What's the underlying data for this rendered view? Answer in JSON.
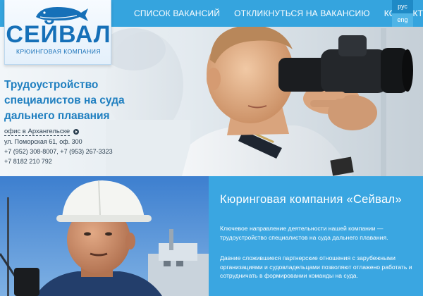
{
  "brand": {
    "logo_name": "СЕЙВАЛ",
    "logo_subtitle": "КРЮИНГОВАЯ КОМПАНИЯ",
    "logo_color": "#1670b8"
  },
  "nav": {
    "items": [
      {
        "label": "СПИСОК ВАКАНСИЙ"
      },
      {
        "label": "ОТКЛИКНУТЬСЯ НА ВАКАНСИЮ"
      },
      {
        "label": "КОНТАКТЫ"
      }
    ],
    "bar_color": "#35a4de"
  },
  "languages": [
    {
      "label": "рус",
      "active": true
    },
    {
      "label": "eng",
      "active": false
    }
  ],
  "hero": {
    "title_lines": [
      "Трудоустройство",
      "специалистов на суда",
      "дальнего плавания"
    ],
    "office_link": "офис в Архангельске",
    "address": "ул. Поморская 61, оф. 300",
    "phones_1": "+7 (952) 308-8007, +7 (953) 267-3323",
    "phones_2": "+7 8182 210 792"
  },
  "about": {
    "title": "Кюринговая компания «Сейвал»",
    "para1_line1": "Ключевое направление деятельности нашей компании —",
    "para1_line2": "трудоустройство специалистов на суда дальнего плавания.",
    "para2_line1": "Давние сложившиеся партнерские отношения с зарубежными",
    "para2_line2": "организациями и судовладельцами позволяют отлажено работать и",
    "para2_line3": "сотрудничать в формировании команды на суда.",
    "panel_color": "#3aa6e1"
  },
  "icons": [
    "whale-icon",
    "arrow-circle-icon",
    "binoculars-icon"
  ]
}
